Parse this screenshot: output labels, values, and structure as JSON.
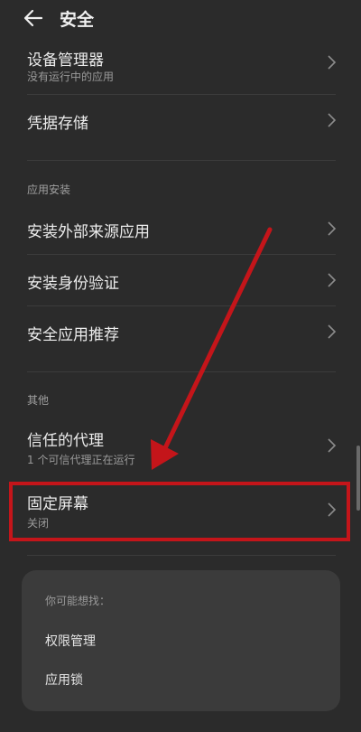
{
  "header": {
    "title": "安全"
  },
  "items": {
    "device_manager": {
      "title": "设备管理器",
      "subtitle": "没有运行中的应用"
    },
    "credential_storage": {
      "title": "凭据存储"
    },
    "install_unknown": {
      "title": "安装外部来源应用"
    },
    "install_verify": {
      "title": "安装身份验证"
    },
    "security_recommend": {
      "title": "安全应用推荐"
    },
    "trust_agents": {
      "title": "信任的代理",
      "subtitle": "1 个可信代理正在运行"
    },
    "screen_pinning": {
      "title": "固定屏幕",
      "subtitle": "关闭"
    }
  },
  "sections": {
    "app_install": "应用安装",
    "other": "其他"
  },
  "suggest": {
    "title": "你可能想找：",
    "links": [
      "权限管理",
      "应用锁"
    ]
  },
  "colors": {
    "background": "#2b2b2b",
    "annotation_red": "#c4151a",
    "card": "#3b3b3b"
  }
}
